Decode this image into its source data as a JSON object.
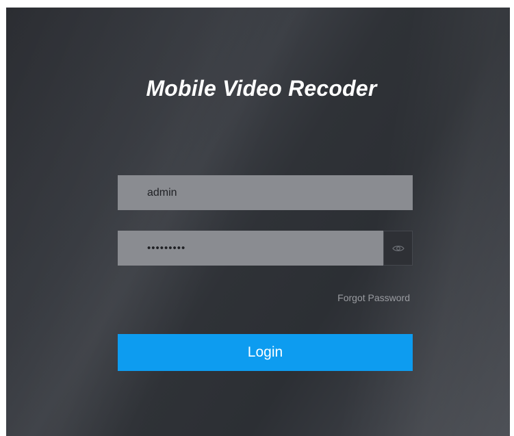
{
  "app": {
    "title": "Mobile Video Recoder"
  },
  "login_form": {
    "username": {
      "value": "admin"
    },
    "password": {
      "value": "•••••••••",
      "visibility_icon": "eye-icon"
    },
    "forgot_password_label": "Forgot Password",
    "login_label": "Login"
  },
  "colors": {
    "accent": "#0d9cf0",
    "background": "#2f3237",
    "field_background": "#8a8c91"
  }
}
